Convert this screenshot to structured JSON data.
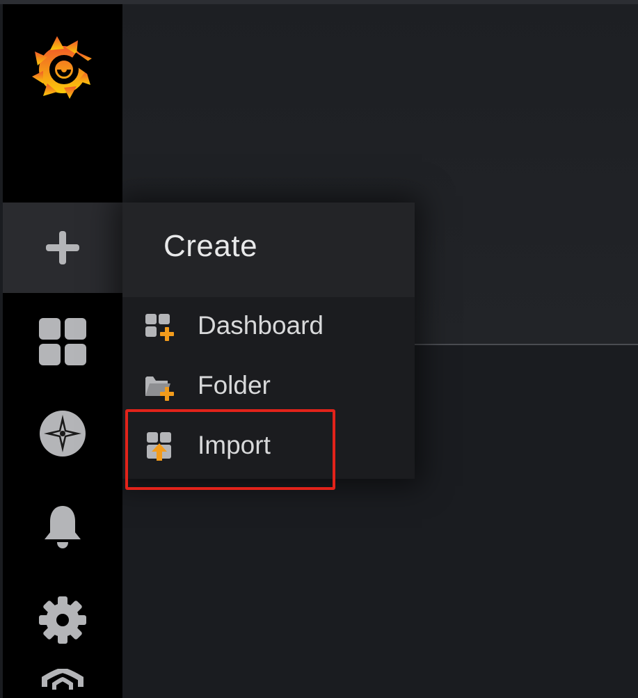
{
  "app": {
    "name": "Grafana"
  },
  "colors": {
    "sidebar_bg": "#000000",
    "active_item_bg": "#2a2b2f",
    "icon_gray": "#b4b5b8",
    "accent_orange": "#f39c1c",
    "highlight_red": "#e2231a"
  },
  "sidebar": {
    "items": [
      {
        "name": "grafana-logo",
        "icon": "grafana-logo-icon"
      },
      {
        "name": "create",
        "icon": "plus-icon",
        "active": true
      },
      {
        "name": "dashboards",
        "icon": "apps-grid-icon"
      },
      {
        "name": "explore",
        "icon": "compass-icon"
      },
      {
        "name": "alerting",
        "icon": "bell-icon"
      },
      {
        "name": "configuration",
        "icon": "gear-icon"
      },
      {
        "name": "server-admin",
        "icon": "shield-icon"
      }
    ]
  },
  "create_menu": {
    "title": "Create",
    "items": [
      {
        "label": "Dashboard",
        "icon": "dashboard-add-icon"
      },
      {
        "label": "Folder",
        "icon": "folder-add-icon"
      },
      {
        "label": "Import",
        "icon": "import-icon",
        "highlighted": true
      }
    ]
  }
}
